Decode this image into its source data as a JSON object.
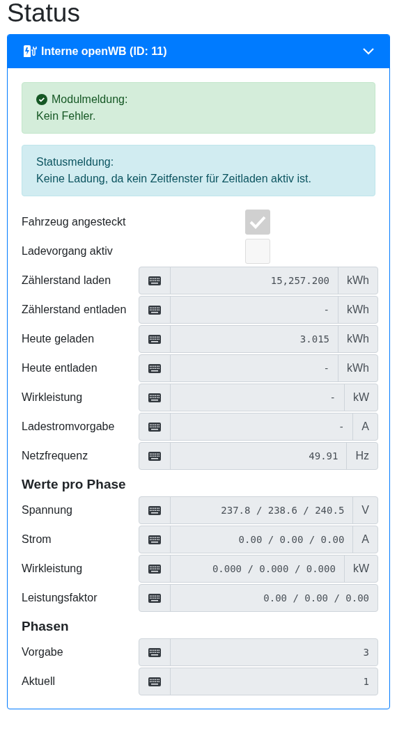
{
  "page_title": "Status",
  "card": {
    "title": "Interne openWB (ID: 11)",
    "expanded": true,
    "alerts": [
      {
        "kind": "success",
        "heading": "Modulmeldung:",
        "text": "Kein Fehler."
      },
      {
        "kind": "info",
        "heading": "Statusmeldung:",
        "text": "Keine Ladung, da kein Zeitfenster für Zeitladen aktiv ist."
      }
    ],
    "sections": [
      {
        "rows": [
          {
            "kind": "checkbox",
            "label": "Fahrzeug angesteckt",
            "checked": true
          },
          {
            "kind": "checkbox",
            "label": "Ladevorgang aktiv",
            "checked": false
          },
          {
            "kind": "value",
            "label": "Zählerstand laden",
            "value": "15,257.200",
            "unit": "kWh"
          },
          {
            "kind": "value",
            "label": "Zählerstand entladen",
            "value": "-",
            "unit": "kWh"
          },
          {
            "kind": "value",
            "label": "Heute geladen",
            "value": "3.015",
            "unit": "kWh"
          },
          {
            "kind": "value",
            "label": "Heute entladen",
            "value": "-",
            "unit": "kWh"
          },
          {
            "kind": "value",
            "label": "Wirkleistung",
            "value": "-",
            "unit": "kW"
          },
          {
            "kind": "value",
            "label": "Ladestromvorgabe",
            "value": "-",
            "unit": "A"
          },
          {
            "kind": "value",
            "label": "Netzfrequenz",
            "value": "49.91",
            "unit": "Hz"
          }
        ]
      },
      {
        "heading": "Werte pro Phase",
        "rows": [
          {
            "kind": "value",
            "label": "Spannung",
            "value": "237.8 / 238.6 / 240.5",
            "unit": "V"
          },
          {
            "kind": "value",
            "label": "Strom",
            "value": "0.00 / 0.00 / 0.00",
            "unit": "A"
          },
          {
            "kind": "value",
            "label": "Wirkleistung",
            "value": "0.000 / 0.000 / 0.000",
            "unit": "kW"
          },
          {
            "kind": "value",
            "label": "Leistungsfaktor",
            "value": "0.00 / 0.00 / 0.00"
          }
        ]
      },
      {
        "heading": "Phasen",
        "rows": [
          {
            "kind": "value",
            "label": "Vorgabe",
            "value": "3"
          },
          {
            "kind": "value",
            "label": "Aktuell",
            "value": "1"
          }
        ]
      }
    ]
  }
}
